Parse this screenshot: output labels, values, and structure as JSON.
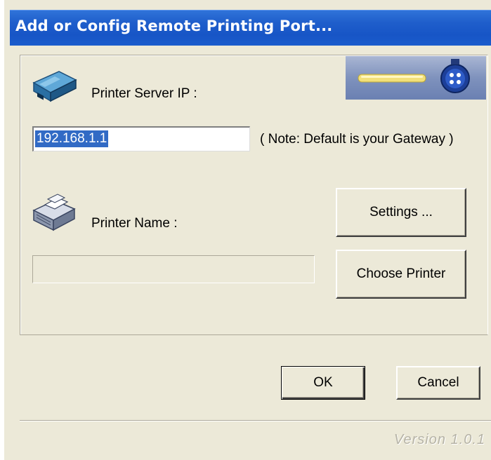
{
  "window": {
    "title": "Add or Config Remote Printing Port..."
  },
  "server": {
    "label": "Printer Server IP :",
    "ip_value": "192.168.1.1",
    "note": "( Note: Default is your Gateway )",
    "icon": "network-device-icon"
  },
  "printer": {
    "label": "Printer Name :",
    "name_value": "",
    "icon": "printer-icon"
  },
  "buttons": {
    "settings": "Settings ...",
    "choose_printer": "Choose Printer",
    "ok": "OK",
    "cancel": "Cancel"
  },
  "footer": {
    "version": "Version 1.0.1"
  },
  "colors": {
    "titlebar": "#1f5ecb",
    "dialog_bg": "#ece9d8",
    "selection": "#316ac5"
  }
}
